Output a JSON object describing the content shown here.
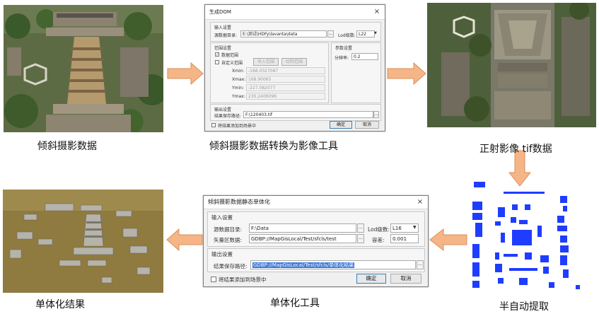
{
  "captions": {
    "oblique_data": "倾斜摄影数据",
    "tool_convert": "倾斜摄影数据转换为影像工具",
    "ortho_tif": "正射影像 tif数据",
    "semi_auto": "半自动提取",
    "monomer_tool": "单体化工具",
    "monomer_result": "单体化结果"
  },
  "dialog_dom": {
    "title": "生成DOM",
    "close": "×",
    "input_group": "输入设置",
    "src_label": "源数据目录:",
    "src_value": "E:\\测试\\HDFy\\lavanta\\data",
    "lod_label": "Lod级数:",
    "lod_value": "L22",
    "range_group": "范围设置",
    "data_range": "数据范围",
    "custom_range": "自定义范围",
    "import_range": "导入范围",
    "draw_range": "绘制范围",
    "xmin_label": "Xmin:",
    "xmin_value": "-168.0327087",
    "xmax_label": "Xmax:",
    "xmax_value": "168.90065",
    "ymin_label": "Ymin:",
    "ymin_value": "-227.082077",
    "ymax_label": "Ymax:",
    "ymax_value": "230.2406096",
    "param_group": "参数设置",
    "res_label": "分辨率:",
    "res_value": "0.2",
    "output_group": "输出设置",
    "out_label": "结果保存路径:",
    "out_value": "F:\\120403.tif",
    "add_to_scene": "将结果添加到场景中",
    "ok": "确定",
    "cancel": "取消"
  },
  "dialog_mono": {
    "title": "倾斜摄影数据静态单体化",
    "close": "×",
    "input_group": "输入设置",
    "src_label": "源数据目录:",
    "src_value": "F:\\Data",
    "lod_label": "Lod级数:",
    "lod_value": "L16",
    "vec_label": "矢量区数据:",
    "vec_value": "GDBP://MapGisLocal/Test/sfcls/test",
    "tol_label": "容差:",
    "tol_value": "0.001",
    "output_group": "输出设置",
    "out_label": "结果保存路径:",
    "out_value": "GDBP://MapGisLocal/Test/sfcls/单体化结果",
    "add_to_scene": "将结果添加到场景中",
    "ok": "确定",
    "cancel": "取消"
  },
  "colors": {
    "arrow_fill": "#f5b587",
    "arrow_stroke": "#d9905a",
    "extract_blue": "#1f3dff"
  }
}
